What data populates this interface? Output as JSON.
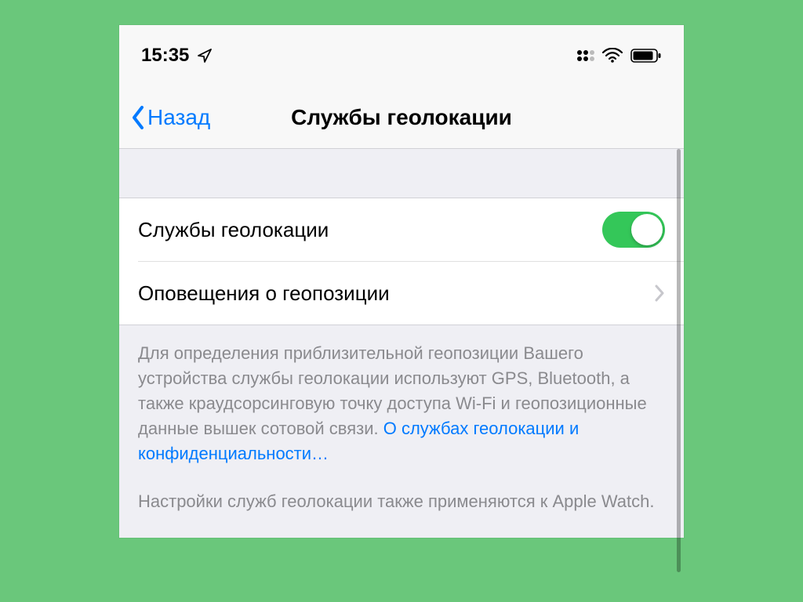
{
  "status_bar": {
    "time": "15:35"
  },
  "nav": {
    "back_label": "Назад",
    "title": "Службы геолокации"
  },
  "cells": {
    "location_services_label": "Службы геолокации",
    "location_services_on": true,
    "location_alerts_label": "Оповещения о геопозиции"
  },
  "footer": {
    "text1": "Для определения приблизительной геопозиции Вашего устройства службы геолокации используют GPS, Bluetooth, а также краудсорсинговую точку доступа Wi-Fi и геопозиционные данные вышек сотовой связи. ",
    "link": "О службах геолокации и конфиденциальности…",
    "text2": "Настройки служб геолокации также применяются к Apple Watch."
  }
}
